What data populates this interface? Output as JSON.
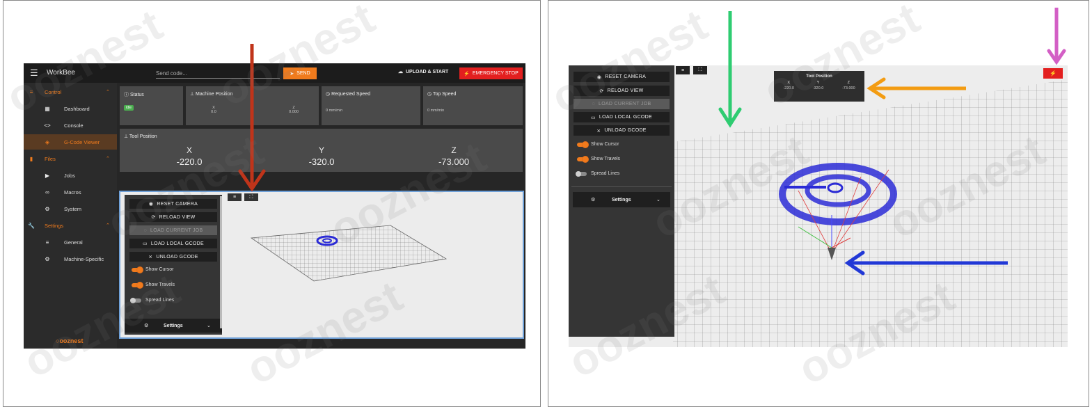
{
  "left": {
    "topbar": {
      "title": "WorkBee",
      "send_placeholder": "Send code...",
      "send_label": "SEND",
      "upload_label": "UPLOAD & START",
      "emergency_label": "EMERGENCY STOP"
    },
    "sidebar": {
      "control": "Control",
      "dashboard": "Dashboard",
      "console": "Console",
      "gcode_viewer": "G-Code Viewer",
      "files": "Files",
      "jobs": "Jobs",
      "macros": "Macros",
      "system": "System",
      "settings": "Settings",
      "general": "General",
      "machine_specific": "Machine-Specific",
      "brand": "ooznest"
    },
    "status": {
      "title": "Status",
      "badge": "Idle"
    },
    "machine_position": {
      "title": "Machine Position",
      "x_label": "X",
      "x_value": "0.0",
      "z_label": "Z",
      "z_value": "0.000"
    },
    "requested_speed": {
      "title": "Requested Speed",
      "value": "0 mm/min"
    },
    "top_speed": {
      "title": "Top Speed",
      "value": "0 mm/min"
    },
    "tool_position": {
      "title": "Tool Position",
      "x_label": "X",
      "x_value": "-220.0",
      "y_label": "Y",
      "y_value": "-320.0",
      "z_label": "Z",
      "z_value": "-73.000"
    },
    "viewer_controls": {
      "reset_camera": "RESET CAMERA",
      "reload_view": "RELOAD VIEW",
      "load_current_job": "LOAD CURRENT JOB",
      "load_local_gcode": "LOAD LOCAL GCODE",
      "unload_gcode": "UNLOAD GCODE",
      "show_cursor": "Show Cursor",
      "show_travels": "Show Travels",
      "spread_lines": "Spread Lines",
      "settings": "Settings"
    }
  },
  "right": {
    "viewer_controls": {
      "reset_camera": "RESET CAMERA",
      "reload_view": "RELOAD VIEW",
      "load_current_job": "LOAD CURRENT JOB",
      "load_local_gcode": "LOAD LOCAL GCODE",
      "unload_gcode": "UNLOAD GCODE",
      "show_cursor": "Show Cursor",
      "show_travels": "Show Travels",
      "spread_lines": "Spread Lines",
      "settings": "Settings"
    },
    "tool_position": {
      "title": "Tool Position",
      "x_label": "X",
      "x_value": "-220.0",
      "y_label": "Y",
      "y_value": "-320.0",
      "z_label": "Z",
      "z_value": "-73.000"
    }
  },
  "colors": {
    "accent": "#f07b1d",
    "emergency": "#e31f1f",
    "annotation_red": "#c0341a",
    "annotation_green": "#2ecc71",
    "annotation_orange": "#f39c12",
    "annotation_magenta": "#d35fc5",
    "annotation_blue": "#2138d6",
    "toolpath_blue": "#2b2bd6"
  },
  "watermark": "ooznest"
}
